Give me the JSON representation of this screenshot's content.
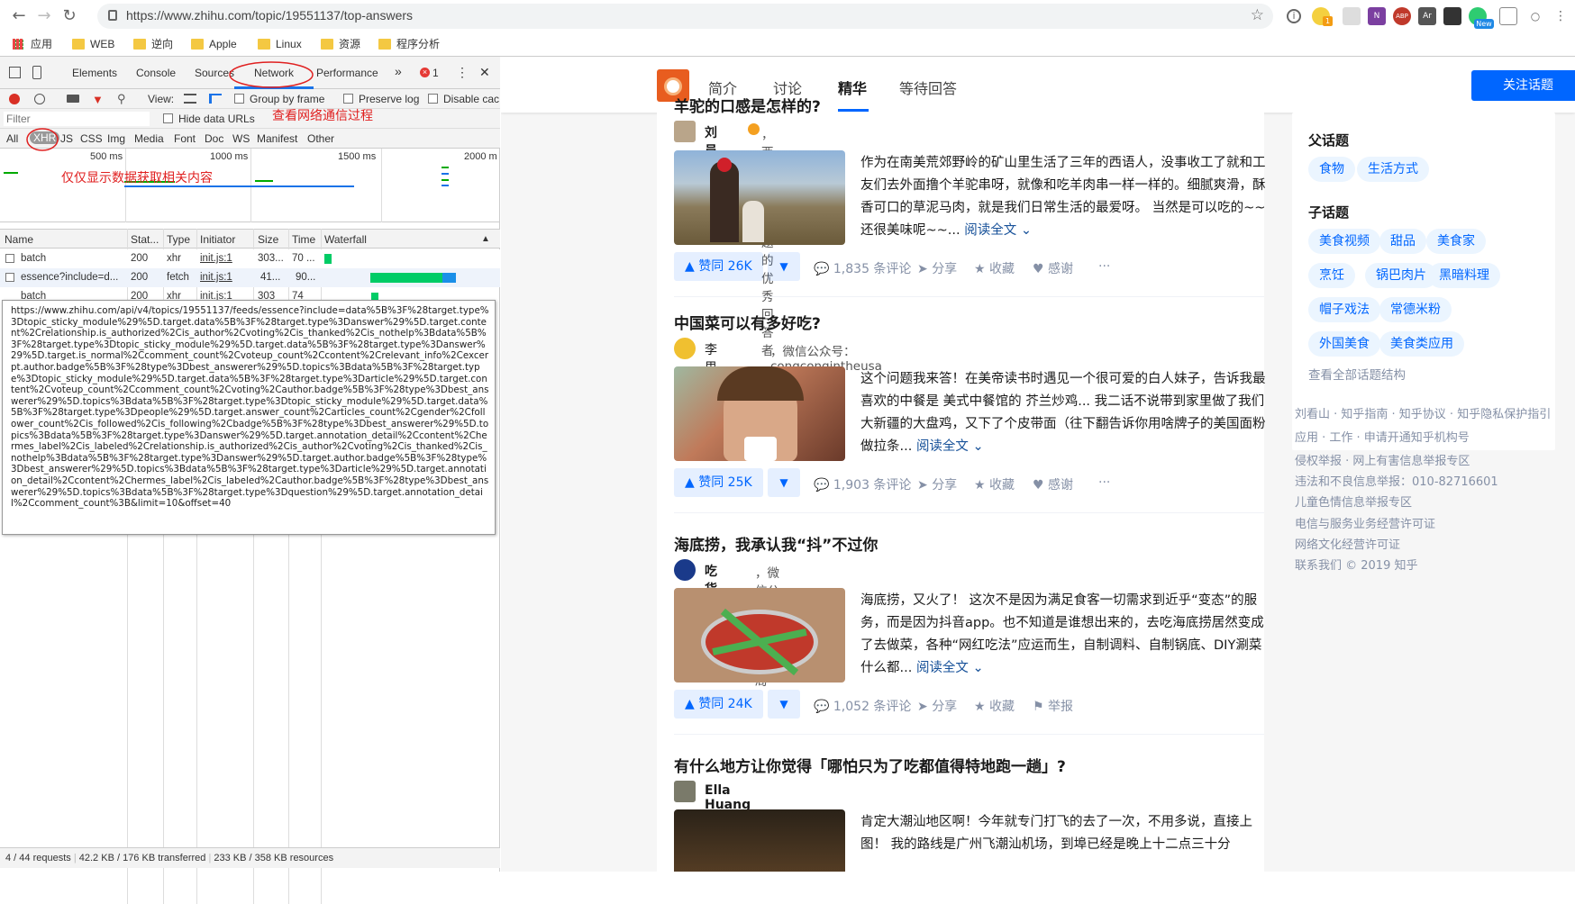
{
  "browser": {
    "url": "https://www.zhihu.com/topic/19551137/top-answers",
    "ext_badge_new": "New",
    "ext_badge_1": "1",
    "bookmarks": [
      "应用",
      "WEB",
      "逆向",
      "Apple",
      "Linux",
      "资源",
      "程序分析"
    ]
  },
  "devtools": {
    "tabs": [
      "Elements",
      "Console",
      "Sources",
      "Network",
      "Performance"
    ],
    "errors": "1",
    "view_label": "View:",
    "group_by_frame": "Group by frame",
    "preserve_log": "Preserve log",
    "disable_cache": "Disable cac",
    "filter_placeholder": "Filter",
    "hide_data_urls": "Hide data URLs",
    "types": [
      "All",
      "XHR",
      "JS",
      "CSS",
      "Img",
      "Media",
      "Font",
      "Doc",
      "WS",
      "Manifest",
      "Other"
    ],
    "timeline_ticks": [
      "500 ms",
      "1000 ms",
      "1500 ms",
      "2000 m"
    ],
    "columns": [
      "Name",
      "Stat...",
      "Type",
      "Initiator",
      "Size",
      "Time",
      "Waterfall"
    ],
    "rows": [
      {
        "name": "batch",
        "status": "200",
        "type": "xhr",
        "initiator": "init.js:1",
        "size": "303...",
        "time": "70 ..."
      },
      {
        "name": "essence?include=d...",
        "status": "200",
        "type": "fetch",
        "initiator": "init.js:1",
        "size": "41...",
        "time": "90..."
      },
      {
        "name": "batch",
        "status": "200",
        "type": "xhr",
        "initiator": "init.js:1",
        "size": "303",
        "time": "74"
      }
    ],
    "tooltip": "https://www.zhihu.com/api/v4/topics/19551137/feeds/essence?include=data%5B%3F%28target.type%3Dtopic_sticky_module%29%5D.target.data%5B%3F%28target.type%3Danswer%29%5D.target.content%2Crelationship.is_authorized%2Cis_author%2Cvoting%2Cis_thanked%2Cis_nothelp%3Bdata%5B%3F%28target.type%3Dtopic_sticky_module%29%5D.target.data%5B%3F%28target.type%3Danswer%29%5D.target.is_normal%2Ccomment_count%2Cvoteup_count%2Ccontent%2Crelevant_info%2Cexcerpt.author.badge%5B%3F%28type%3Dbest_answerer%29%5D.topics%3Bdata%5B%3F%28target.type%3Dtopic_sticky_module%29%5D.target.data%5B%3F%28target.type%3Darticle%29%5D.target.content%2Cvoteup_count%2Ccomment_count%2Cvoting%2Cauthor.badge%5B%3F%28type%3Dbest_answerer%29%5D.topics%3Bdata%5B%3F%28target.type%3Dtopic_sticky_module%29%5D.target.data%5B%3F%28target.type%3Dpeople%29%5D.target.answer_count%2Carticles_count%2Cgender%2Cfollower_count%2Cis_followed%2Cis_following%2Cbadge%5B%3F%28type%3Dbest_answerer%29%5D.topics%3Bdata%5B%3F%28target.type%3Danswer%29%5D.target.annotation_detail%2Ccontent%2Chermes_label%2Cis_labeled%2Crelationship.is_authorized%2Cis_author%2Cvoting%2Cis_thanked%2Cis_nothelp%3Bdata%5B%3F%28target.type%3Danswer%29%5D.target.author.badge%5B%3F%28type%3Dbest_answerer%29%5D.topics%3Bdata%5B%3F%28target.type%3Darticle%29%5D.target.annotation_detail%2Ccontent%2Chermes_label%2Cis_labeled%2Cauthor.badge%5B%3F%28type%3Dbest_answerer%29%5D.topics%3Bdata%5B%3F%28target.type%3Dquestion%29%5D.target.annotation_detail%2Ccomment_count%3B&limit=10&offset=40",
    "status_requests": "4 / 44 requests",
    "status_transferred": "42.2 KB / 176 KB transferred",
    "status_resources": "233 KB / 358 KB resources",
    "annotation_network": "查看网络通信过程",
    "annotation_xhr": "仅仅显示数据获取相关内容"
  },
  "zhihu": {
    "tabs": [
      "简介",
      "讨论",
      "精华",
      "等待回答"
    ],
    "follow_button": "关注话题",
    "items": [
      {
        "question": "羊驼的口感是怎样的?",
        "author": "刘员外",
        "headline": "，西班牙语 话题的优秀回答者",
        "excerpt": "作为在南美荒郊野岭的矿山里生活了三年的西语人，没事收工了就和工友们去外面撸个羊驼串呀，就像和吃羊肉串一样一样的。细腻爽滑，酥香可口的草泥马肉，就是我们日常生活的最爱呀。 当然是可以吃的~~还很美味呢~~...",
        "read_more": "阅读全文",
        "votes": "赞同 26K",
        "comments": "1,835 条评论",
        "share": "分享",
        "collect": "收藏",
        "thanks": "感谢"
      },
      {
        "question": "中国菜可以有多好吃?",
        "author": "李思聪Leo",
        "headline": "，微信公众号：congcongintheusa",
        "excerpt": "这个问题我来答！在美帝读书时遇见一个很可爱的白人妹子，告诉我最喜欢的中餐是 美式中餐馆的 芥兰炒鸡... 我二话不说带到家里做了我们大新疆的大盘鸡，又下了个皮带面（往下翻告诉你用啥牌子的美国面粉做拉条...",
        "read_more": "阅读全文",
        "votes": "赞同 25K",
        "comments": "1,903 条评论",
        "share": "分享",
        "collect": "收藏",
        "thanks": "感谢"
      },
      {
        "question": "海底捞，我承认我“抖”不过你",
        "author": "吃货组长",
        "headline": "，微信公众号：魔都食羹局",
        "excerpt": "海底捞，又火了！ 这次不是因为满足食客一切需求到近乎“变态”的服务，而是因为抖音app。也不知道是谁想出来的，去吃海底捞居然变成了去做菜，各种“网红吃法”应运而生，自制调料、自制锅底、DIY涮菜什么都...",
        "read_more": "阅读全文",
        "votes": "赞同 24K",
        "comments": "1,052 条评论",
        "share": "分享",
        "collect": "收藏",
        "thanks": "举报"
      },
      {
        "question": "有什么地方让你觉得「哪怕只为了吃都值得特地跑一趟」?",
        "author": "Ella Huang",
        "headline": "",
        "excerpt": "肯定大潮汕地区啊！今年就专门打飞的去了一次，不用多说，直接上图！ 我的路线是广州飞潮汕机场，到埠已经是晚上十二点三十分",
        "read_more": "",
        "votes": "",
        "comments": "",
        "share": "",
        "collect": "",
        "thanks": ""
      }
    ],
    "sidebar": {
      "parent_title": "父话题",
      "parent_tags": [
        "食物",
        "生活方式"
      ],
      "child_title": "子话题",
      "child_tags": [
        "美食视频",
        "甜品",
        "美食家",
        "烹饪",
        "锅巴肉片",
        "黑暗料理",
        "帽子戏法",
        "常德米粉",
        "外国美食",
        "美食类应用"
      ],
      "view_all": "查看全部话题结构"
    },
    "footer": [
      "刘看山 · 知乎指南 · 知乎协议 · 知乎隐私保护指引",
      "应用 · 工作 · 申请开通知乎机构号",
      "侵权举报 · 网上有害信息举报专区",
      "违法和不良信息举报：010-82716601",
      "儿童色情信息举报专区",
      "电信与服务业务经营许可证",
      "网络文化经营许可证",
      "联系我们 © 2019 知乎"
    ]
  }
}
